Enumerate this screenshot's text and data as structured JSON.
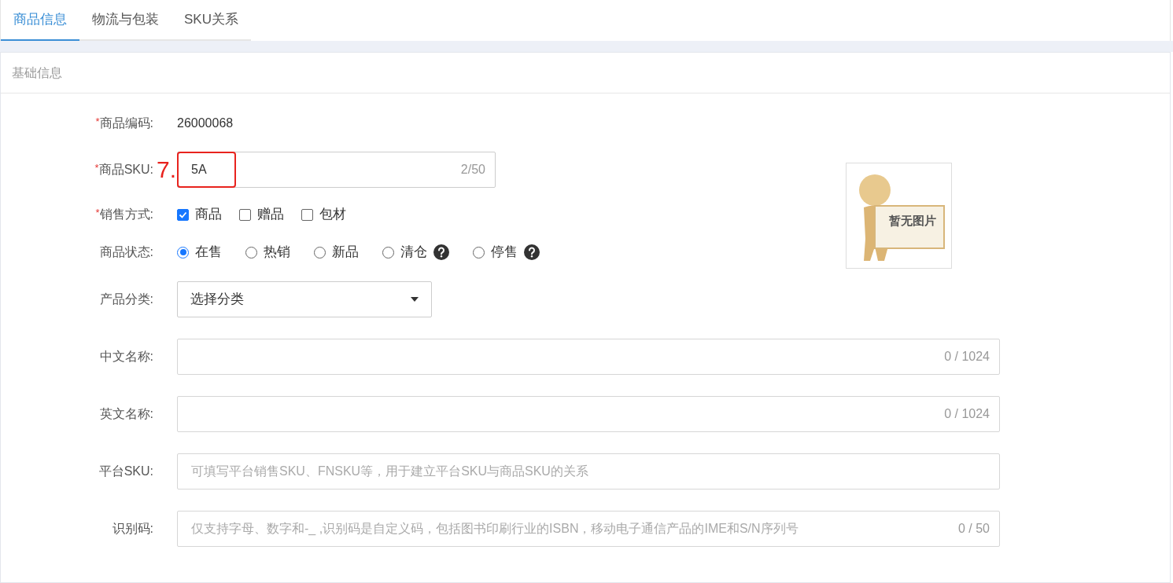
{
  "tabs": [
    {
      "label": "商品信息",
      "selected": true
    },
    {
      "label": "物流与包装",
      "selected": false
    },
    {
      "label": "SKU关系",
      "selected": false
    }
  ],
  "section": {
    "title": "基础信息"
  },
  "product_code": {
    "label": "商品编码:",
    "required_mark": "*",
    "value": "26000068"
  },
  "product_sku": {
    "label": "商品SKU:",
    "required_mark": "*",
    "value": "5A",
    "counter": "2/50",
    "annotation": "7."
  },
  "sale_type": {
    "label": "销售方式:",
    "required_mark": "*",
    "options": [
      {
        "label": "商品",
        "checked": true
      },
      {
        "label": "赠品",
        "checked": false
      },
      {
        "label": "包材",
        "checked": false
      }
    ]
  },
  "product_status": {
    "label": "商品状态:",
    "options": [
      {
        "label": "在售",
        "selected": true,
        "help": false
      },
      {
        "label": "热销",
        "selected": false,
        "help": false
      },
      {
        "label": "新品",
        "selected": false,
        "help": false
      },
      {
        "label": "清仓",
        "selected": false,
        "help": true
      },
      {
        "label": "停售",
        "selected": false,
        "help": true
      }
    ]
  },
  "category": {
    "label": "产品分类:",
    "value": "选择分类"
  },
  "fields": [
    {
      "label": "中文名称:",
      "counter": "0 / 1024"
    },
    {
      "label": "英文名称:",
      "counter": "0 / 1024"
    },
    {
      "label": "平台SKU:",
      "placeholder": "可填写平台销售SKU、FNSKU等，用于建立平台SKU与商品SKU的关系"
    },
    {
      "label": "识别码:",
      "placeholder": "仅支持字母、数字和-_ ,识别码是自定义码，包括图书印刷行业的ISBN，移动电子通信产品的IME和S/N序列号",
      "counter": "0 / 50"
    }
  ],
  "image": {
    "text": "暂无图片"
  }
}
